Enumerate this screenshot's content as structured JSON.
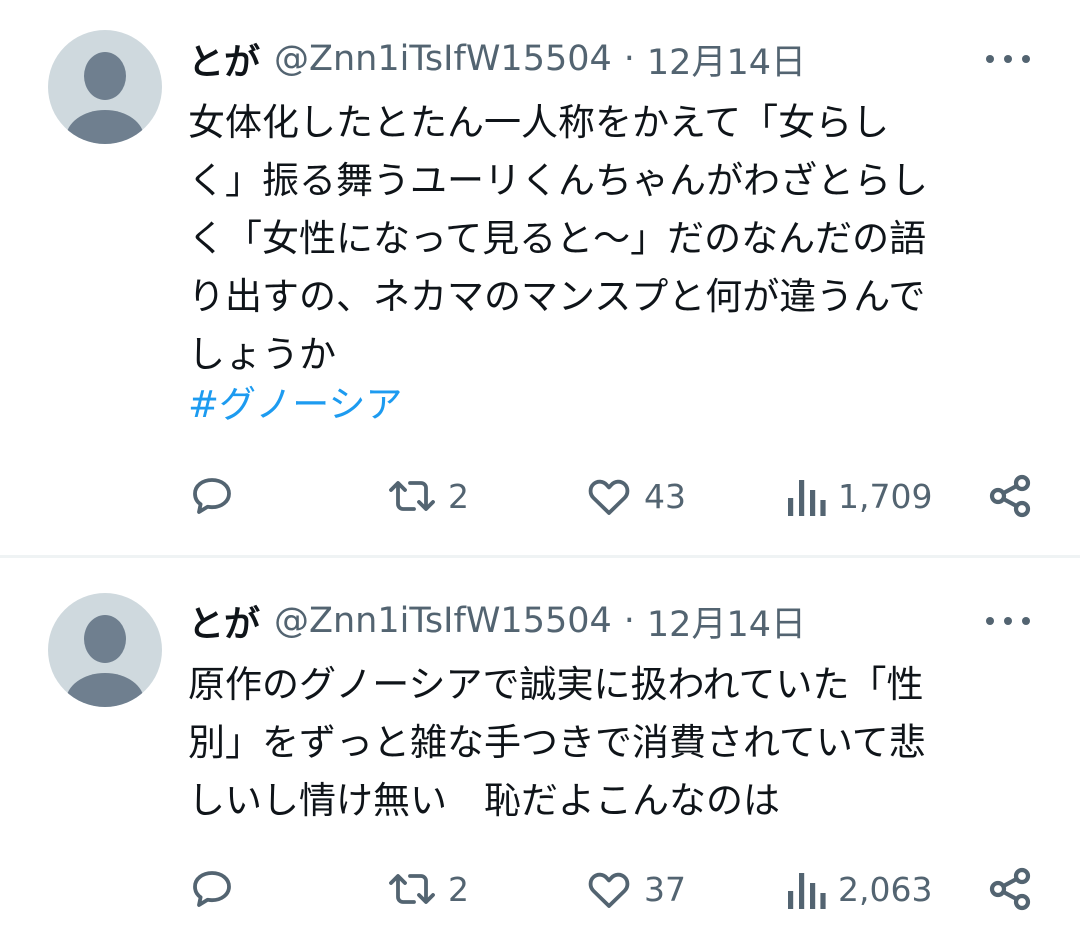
{
  "tweets": [
    {
      "author": {
        "name": "とが",
        "handle": "@Znn1iTsIfW15504"
      },
      "separator": "·",
      "date": "12月14日",
      "text": "女体化したとたん一人称をかえて「女らし\nく」振る舞うユーリくんちゃんがわざとらし\nく「女性になって見ると〜」だのなんだの語\nり出すの、ネカマのマンスプと何が違うんで\nしょうか",
      "hashtag": "#グノーシア",
      "stats": {
        "replies": "",
        "retweets": "2",
        "likes": "43",
        "views": "1,709"
      }
    },
    {
      "author": {
        "name": "とが",
        "handle": "@Znn1iTsIfW15504"
      },
      "separator": "·",
      "date": "12月14日",
      "text": "原作のグノーシアで誠実に扱われていた「性\n別」をずっと雑な手つきで消費されていて悲\nしいし情け無い　恥だよこんなのは",
      "hashtag": "",
      "stats": {
        "replies": "",
        "retweets": "2",
        "likes": "37",
        "views": "2,063"
      }
    }
  ],
  "icons": {
    "avatar": "default-avatar-icon",
    "more": "more-options-icon",
    "reply": "reply-icon",
    "retweet": "retweet-icon",
    "like": "heart-icon",
    "views": "views-icon",
    "share": "share-icon"
  },
  "colors": {
    "text": "#0f1419",
    "secondary": "#536471",
    "link": "#1d9bf0",
    "divider": "#eff3f4"
  }
}
